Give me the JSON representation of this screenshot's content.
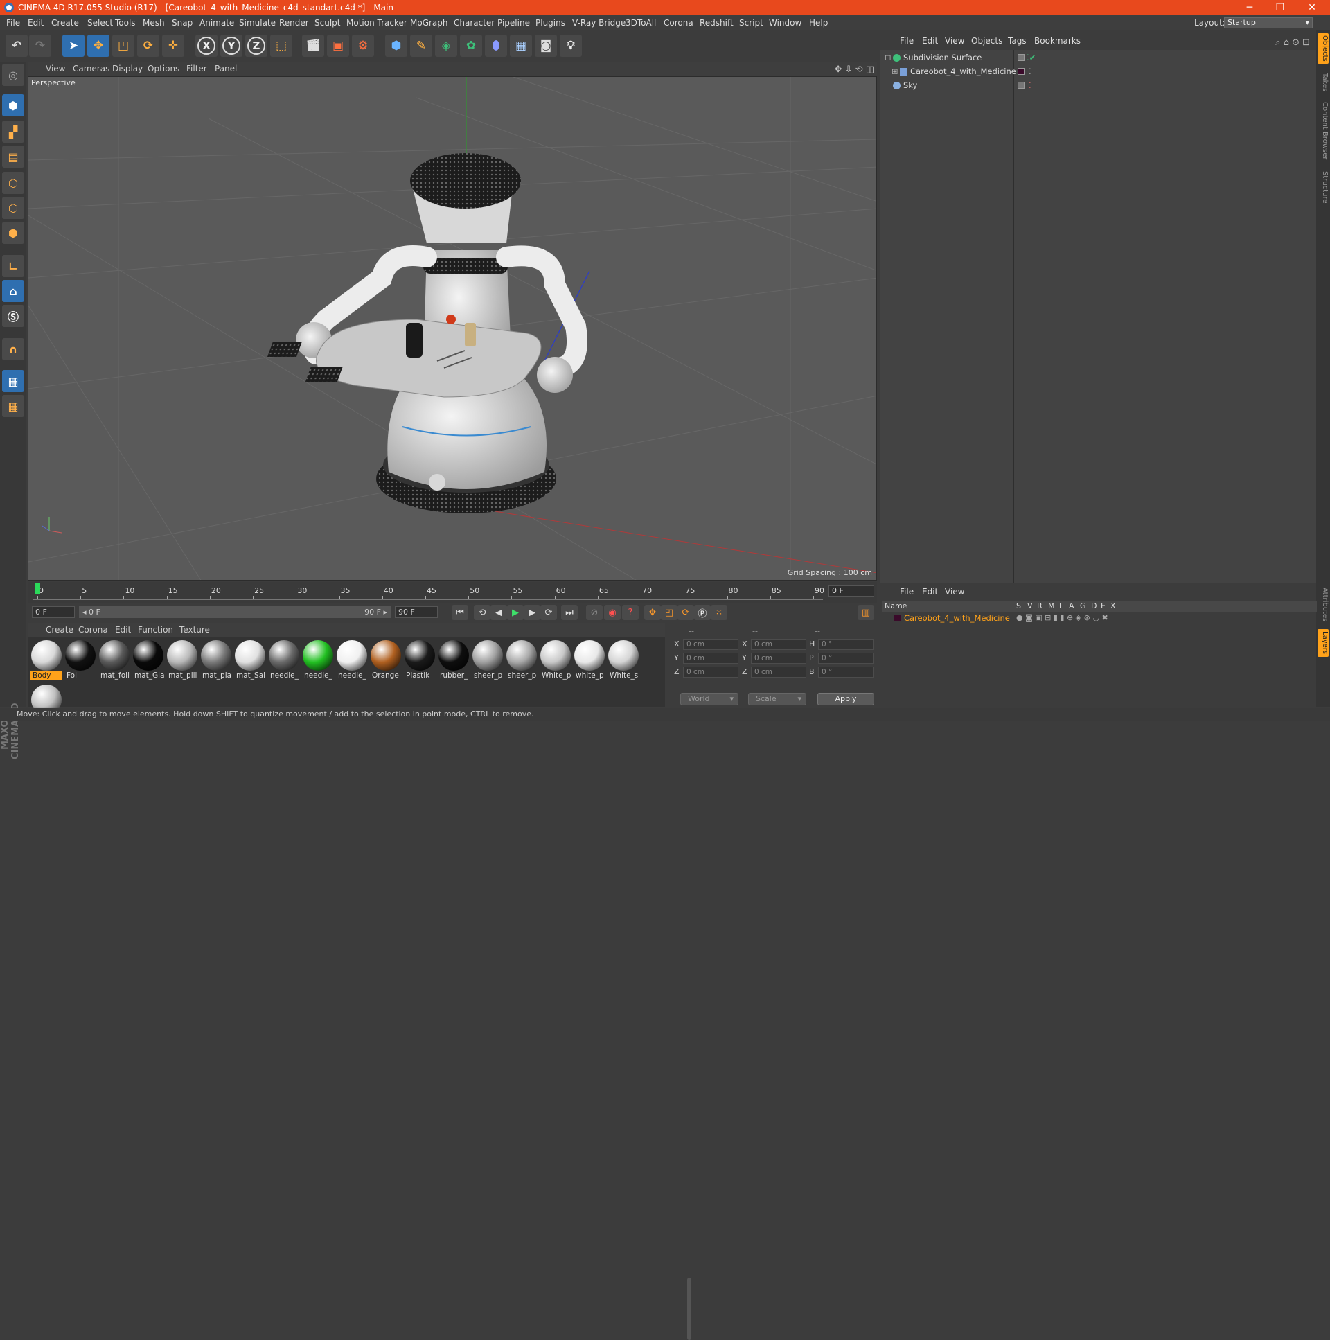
{
  "title_bar": {
    "text": "CINEMA 4D R17.055 Studio (R17) - [Careobot_4_with_Medicine_c4d_standart.c4d *] - Main",
    "minimize": "─",
    "restore": "❐",
    "close": "✕"
  },
  "menu": [
    "File",
    "Edit",
    "Create",
    "Select",
    "Tools",
    "Mesh",
    "Snap",
    "Animate",
    "Simulate",
    "Render",
    "Sculpt",
    "Motion Tracker",
    "MoGraph",
    "Character",
    "Pipeline",
    "Plugins",
    "V-Ray Bridge",
    "3DToAll",
    "Corona",
    "Redshift",
    "Script",
    "Window",
    "Help"
  ],
  "layout": {
    "label": "Layout:",
    "value": "Startup"
  },
  "viewport": {
    "menu": [
      "View",
      "Cameras",
      "Display",
      "Options",
      "Filter",
      "Panel"
    ],
    "label": "Perspective",
    "grid_spacing": "Grid Spacing : 100 cm",
    "icons": "✥ ⇩ ⟲ ◫"
  },
  "timeline": {
    "ticks": [
      "0",
      "5",
      "10",
      "15",
      "20",
      "25",
      "30",
      "35",
      "40",
      "45",
      "50",
      "55",
      "60",
      "65",
      "70",
      "75",
      "80",
      "85",
      "90"
    ],
    "frame_display": "0 F"
  },
  "transport": {
    "start": "0 F",
    "range_start": "◂ 0 F",
    "range_end": "90 F ▸",
    "end": "90 F"
  },
  "materials": {
    "menu": [
      "Create",
      "Corona",
      "Edit",
      "Function",
      "Texture"
    ],
    "items": [
      {
        "label": "Body",
        "color": "#d8d8d8",
        "selected": true
      },
      {
        "label": "Foil",
        "color": "#111111"
      },
      {
        "label": "mat_foil",
        "color": "#5a5a5a"
      },
      {
        "label": "mat_Gla",
        "color": "#0a0a0a"
      },
      {
        "label": "mat_pill",
        "color": "#b8b8b8"
      },
      {
        "label": "mat_pla",
        "color": "#7a7a7a"
      },
      {
        "label": "mat_Sal",
        "color": "#e0e0e0"
      },
      {
        "label": "needle_",
        "color": "#6a6a6a"
      },
      {
        "label": "needle_",
        "color": "#22c022"
      },
      {
        "label": "needle_",
        "color": "#f0f0f0"
      },
      {
        "label": "Orange",
        "color": "#b06020"
      },
      {
        "label": "Plastik",
        "color": "#1a1a1a"
      },
      {
        "label": "rubber_",
        "color": "#0e0e0e"
      },
      {
        "label": "sheer_p",
        "color": "#a0a0a0"
      },
      {
        "label": "sheer_p",
        "color": "#a8a8a8"
      },
      {
        "label": "White_p",
        "color": "#c8c8c8"
      },
      {
        "label": "white_p",
        "color": "#e8e8e8"
      },
      {
        "label": "White_s",
        "color": "#d4d4d4"
      },
      {
        "label": "",
        "color": "#c0c0c0"
      }
    ]
  },
  "coordinates": {
    "header": [
      "--",
      "--",
      "--"
    ],
    "rows": [
      {
        "a": "X",
        "av": "0 cm",
        "b": "X",
        "bv": "0 cm",
        "c": "H",
        "cv": "0 °"
      },
      {
        "a": "Y",
        "av": "0 cm",
        "b": "Y",
        "bv": "0 cm",
        "c": "P",
        "cv": "0 °"
      },
      {
        "a": "Z",
        "av": "0 cm",
        "b": "Z",
        "bv": "0 cm",
        "c": "B",
        "cv": "0 °"
      }
    ],
    "world": "World",
    "scale": "Scale",
    "apply": "Apply"
  },
  "objects": {
    "menu": [
      "File",
      "Edit",
      "View",
      "Objects",
      "Tags",
      "Bookmarks"
    ],
    "rows": [
      {
        "name": "Subdivision Surface",
        "icon_color": "#3ec07a"
      },
      {
        "name": "Careobot_4_with_Medicine",
        "icon_color": "#7aa0d8"
      },
      {
        "name": "Sky",
        "icon_color": "#8ab0e0"
      }
    ],
    "icons": "⌕ ⌂ ⊙ ⊡"
  },
  "right_tabs": [
    "Objects",
    "Takes",
    "Content Browser",
    "Structure"
  ],
  "right_tabs_bottom": [
    "Attributes",
    "Layers"
  ],
  "layers": {
    "menu": [
      "File",
      "Edit",
      "View"
    ],
    "columns": [
      "Name",
      "S",
      "V",
      "R",
      "M",
      "L",
      "A",
      "G",
      "D",
      "E",
      "X"
    ],
    "row": "Careobot_4_with_Medicine"
  },
  "status": "Move: Click and drag to move elements. Hold down SHIFT to quantize movement / add to the selection in point mode, CTRL to remove.",
  "brand": "MAXON CINEMA 4D"
}
